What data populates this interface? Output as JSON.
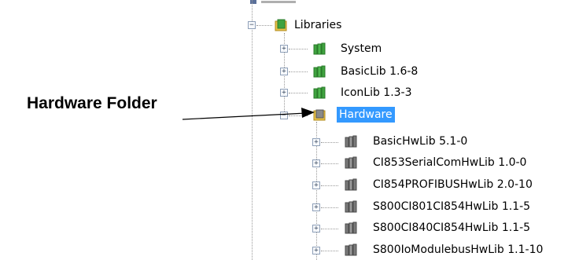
{
  "callout": {
    "text": "Hardware Folder"
  },
  "tree": {
    "root": {
      "label": "Libraries",
      "expander": "−",
      "icon": "library-folder-icon"
    },
    "libraries": [
      {
        "label": "System",
        "expander": "+",
        "icon": "green-library-icon"
      },
      {
        "label": "BasicLib 1.6-8",
        "expander": "+",
        "icon": "green-library-icon"
      },
      {
        "label": "IconLib 1.3-3",
        "expander": "+",
        "icon": "green-library-icon"
      }
    ],
    "hardware": {
      "label": "Hardware",
      "expander": "−",
      "icon": "hardware-folder-icon",
      "selected": true
    },
    "hardware_items": [
      {
        "label": "BasicHwLib 5.1-0",
        "expander": "+",
        "icon": "gray-library-icon"
      },
      {
        "label": "CI853SerialComHwLib 1.0-0",
        "expander": "+",
        "icon": "gray-library-icon"
      },
      {
        "label": "CI854PROFIBUSHwLib 2.0-10",
        "expander": "+",
        "icon": "gray-library-icon"
      },
      {
        "label": "S800CI801CI854HwLib 1.1-5",
        "expander": "+",
        "icon": "gray-library-icon"
      },
      {
        "label": "S800CI840CI854HwLib 1.1-5",
        "expander": "+",
        "icon": "gray-library-icon"
      },
      {
        "label": "S800IoModulebusHwLib 1.1-10",
        "expander": "+",
        "icon": "gray-library-icon"
      }
    ]
  },
  "colors": {
    "selection": "#3399ff",
    "green_library": "#3fa33f",
    "gray_library": "#7a7a7a",
    "folder_yellow": "#e8c24a"
  }
}
